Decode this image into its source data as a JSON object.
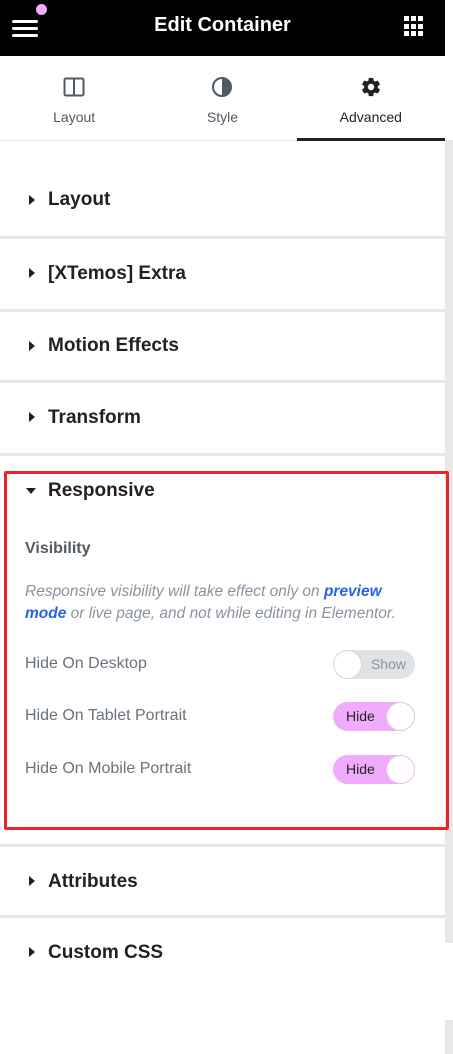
{
  "header": {
    "title": "Edit Container"
  },
  "tabs": [
    {
      "label": "Layout",
      "icon": "layout-icon"
    },
    {
      "label": "Style",
      "icon": "half-circle-style-icon"
    },
    {
      "label": "Advanced",
      "icon": "gear-icon",
      "active": true
    }
  ],
  "sections": {
    "layout": "Layout",
    "xtemos": "[XTemos] Extra",
    "motion": "Motion Effects",
    "transform": "Transform",
    "responsive": "Responsive",
    "attributes": "Attributes",
    "custom_css": "Custom CSS"
  },
  "responsive": {
    "heading": "Visibility",
    "note_part1": "Responsive visibility will take effect only on ",
    "note_link": "preview mode",
    "note_part2": " or live page, and not while editing in Elementor.",
    "controls": [
      {
        "label": "Hide On Desktop",
        "state": "Show",
        "on": false
      },
      {
        "label": "Hide On Tablet Portrait",
        "state": "Hide",
        "on": true
      },
      {
        "label": "Hide On Mobile Portrait",
        "state": "Hide",
        "on": true
      }
    ]
  },
  "colors": {
    "header_bg": "#000000",
    "toggle_on": "#f0abfc",
    "highlight": "#ee2222",
    "link": "#2563eb"
  }
}
